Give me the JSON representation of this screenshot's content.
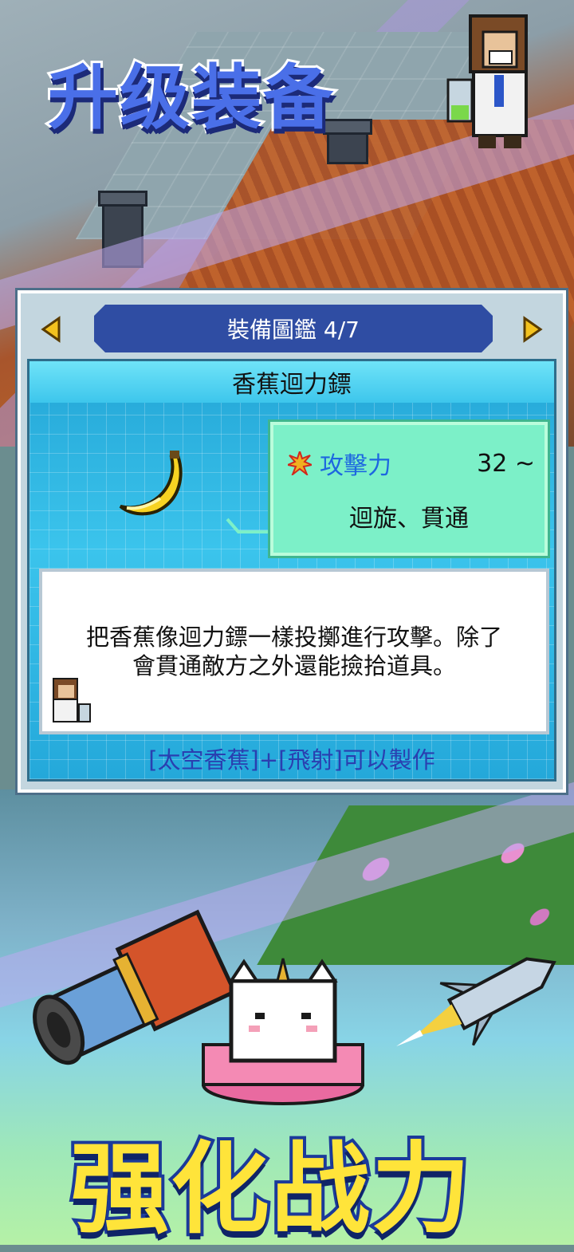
{
  "banner_top": "升级装备",
  "banner_bottom": "强化战力",
  "panel": {
    "header_title": "裝備圖鑑 4/7",
    "item_name": "香蕉迴力鏢",
    "stat_label": "攻擊力",
    "stat_value": "32 ~",
    "stat_traits": "迴旋、貫通",
    "description_line1": "把香蕉像迴力鏢一樣投擲進行攻擊。除了",
    "description_line2": "會貫通敵方之外還能撿拾道具。",
    "craft_recipe": "[太空香蕉]+[飛射]可以製作"
  },
  "icons": {
    "prev": "prev-arrow-icon",
    "next": "next-arrow-icon",
    "attack": "burst-icon",
    "item": "banana-icon"
  },
  "colors": {
    "header_blue": "#2f4da3",
    "stat_label": "#1d67e0",
    "stats_bg": "#7cf0c8",
    "craft_text": "#2a3fb0",
    "banner_top": "#4a6fe8",
    "banner_bottom": "#ffe43a"
  }
}
